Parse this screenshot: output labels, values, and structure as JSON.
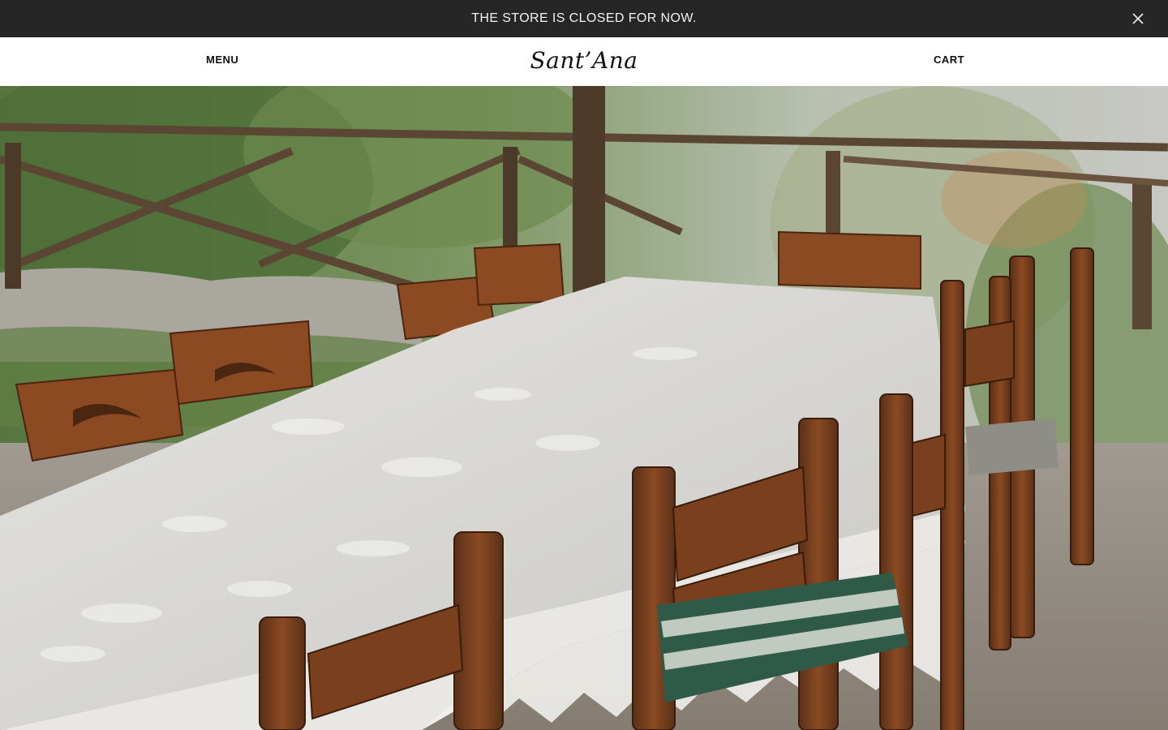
{
  "announcement": {
    "text": "THE STORE IS CLOSED FOR NOW.",
    "close_icon": "close-icon"
  },
  "header": {
    "menu_label": "MENU",
    "logo_text": "Sant’Ana",
    "cart_label": "CART"
  },
  "hero": {
    "image_subject": "outdoor long table with white tablecloth and wooden chairs"
  },
  "colors": {
    "announcement_bg": "#262626",
    "announcement_text": "#f2f2f2",
    "header_bg": "#ffffff",
    "text": "#111111"
  }
}
